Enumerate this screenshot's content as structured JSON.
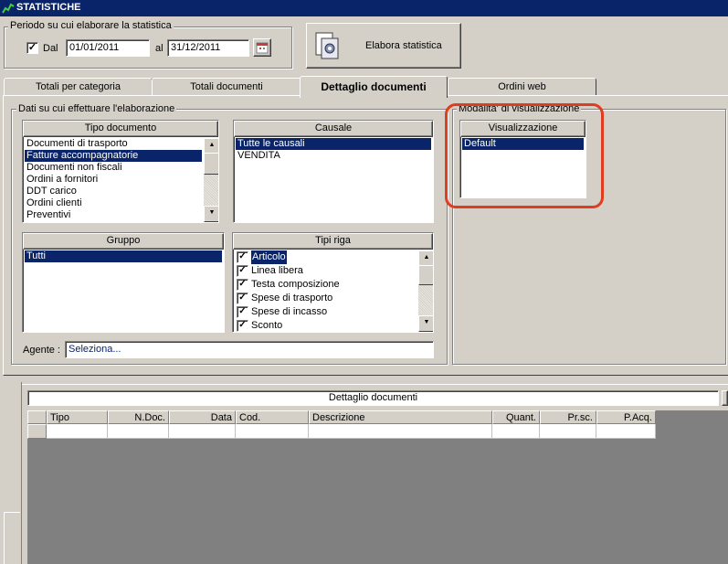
{
  "window": {
    "title": "STATISTICHE"
  },
  "period": {
    "legend": "Periodo su cui elaborare la statistica",
    "check_mark": "✓",
    "from_label": "Dal",
    "from_value": "01/01/2011",
    "to_label": "al",
    "to_value": "31/12/2011"
  },
  "elabora_button": {
    "label": "Elabora statistica"
  },
  "tabs": [
    {
      "label": "Totali per categoria",
      "active": false
    },
    {
      "label": "Totali documenti",
      "active": false
    },
    {
      "label": "Dettaglio documenti",
      "active": true
    },
    {
      "label": "Ordini web",
      "active": false
    }
  ],
  "filters": {
    "legend": "Dati su cui effettuare l'elaborazione",
    "tipo_documento": {
      "header": "Tipo documento",
      "items": [
        "Documenti di trasporto",
        "Fatture accompagnatorie",
        "Documenti non fiscali",
        "Ordini a fornitori",
        "DDT carico",
        "Ordini clienti",
        "Preventivi"
      ],
      "selected_index": 1
    },
    "causale": {
      "header": "Causale",
      "items": [
        "Tutte le causali",
        "VENDITA"
      ],
      "selected_index": 0
    },
    "gruppo": {
      "header": "Gruppo",
      "items": [
        "Tutti"
      ],
      "selected_index": 0
    },
    "tipi_riga": {
      "header": "Tipi riga",
      "items": [
        "Articolo",
        "Linea libera",
        "Testa composizione",
        "Spese di trasporto",
        "Spese di incasso",
        "Sconto"
      ],
      "selected_index": 0
    },
    "agente": {
      "label": "Agente :",
      "value": "Seleziona..."
    }
  },
  "visualizzazione": {
    "legend": "Modalita' di visualizzazione",
    "header": "Visualizzazione",
    "items": [
      "Default"
    ],
    "selected_index": 0,
    "highlight_color": "#e03c1e"
  },
  "results": {
    "title": "Dettaglio documenti",
    "columns": [
      "Tipo",
      "N.Doc.",
      "Data",
      "Cod.",
      "Descrizione",
      "Quant.",
      "Pr.sc.",
      "P.Acq."
    ]
  },
  "colors": {
    "selection": "#0a246a",
    "face": "#d4d0c8",
    "grid_bg": "#808080"
  }
}
